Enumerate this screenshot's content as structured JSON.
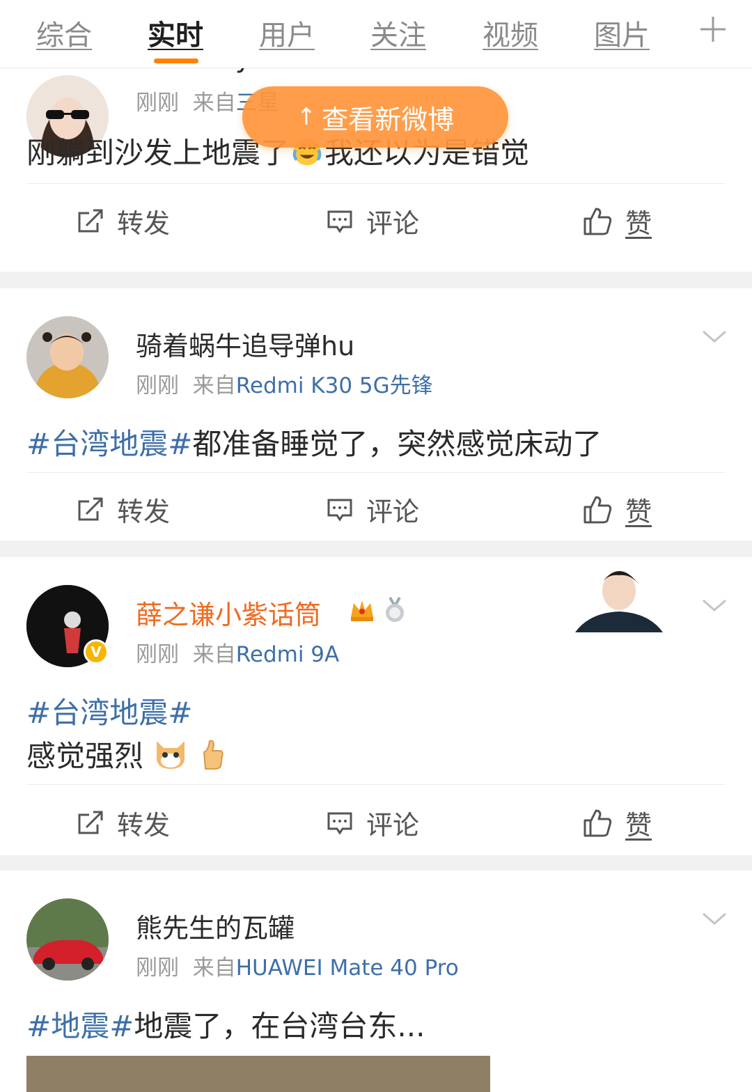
{
  "tabs": [
    "综合",
    "实时",
    "用户",
    "关注",
    "视频",
    "图片"
  ],
  "active_tab": "实时",
  "toast": {
    "arrow": "↑",
    "label": "查看新微博"
  },
  "actions": {
    "repost": "转发",
    "comment": "评论",
    "like": "赞"
  },
  "posts": [
    {
      "username": "LSY---lsy",
      "time": "刚刚",
      "from_prefix": "来自",
      "source": "三星",
      "text": "刚躺到沙发上地震了",
      "emoji": "cry-laugh-emoji",
      "text_after": "我还以为是错觉"
    },
    {
      "username": "骑着蜗牛追导弹hu",
      "time": "刚刚",
      "from_prefix": "来自",
      "source": "Redmi K30 5G先锋",
      "hashtag": "#台湾地震#",
      "text": "都准备睡觉了，突然感觉床动了"
    },
    {
      "username": "薛之谦小紫话筒",
      "time": "刚刚",
      "from_prefix": "来自",
      "source": "Redmi 9A",
      "verified": "V",
      "hashtag": "#台湾地震#",
      "text": "感觉强烈",
      "emoji": [
        "cat-emoji",
        "thumbs-up-emoji"
      ]
    },
    {
      "username": "熊先生的瓦罐",
      "time": "刚刚",
      "from_prefix": "来自",
      "source": "HUAWEI Mate 40 Pro",
      "hashtag": "#地震#",
      "text": "地震了，在台湾台东..."
    }
  ],
  "colors": {
    "accent": "#ff8200",
    "link": "#3e6fa8",
    "vip_name": "#f06a20"
  }
}
